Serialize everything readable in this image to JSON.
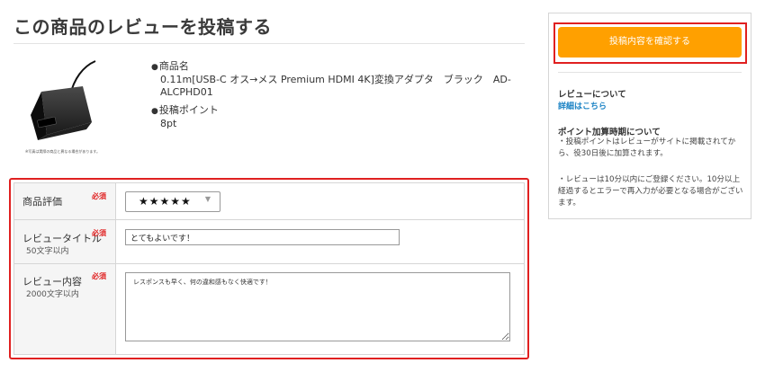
{
  "header": {
    "title": "この商品のレビューを投稿する"
  },
  "product": {
    "image_caption": "※写真は実際の商品と異なる場合があります。",
    "name_label": "商品名",
    "name": "0.11m[USB-C オス→メス Premium HDMI 4K]変換アダプタ　ブラック　AD-ALCPHD01",
    "points_label": "投稿ポイント",
    "points": "8pt"
  },
  "form": {
    "required_label": "必須",
    "rating": {
      "label": "商品評価",
      "value": "★★★★★"
    },
    "title": {
      "label": "レビュータイトル",
      "hint": "50文字以内",
      "value": "とてもよいです！"
    },
    "content": {
      "label": "レビュー内容",
      "hint": "2000文字以内",
      "value": "レスポンスも早く、何の違和感もなく快適です！"
    }
  },
  "sidebar": {
    "confirm_button": "投稿内容を確認する",
    "about_heading": "レビューについて",
    "details_link": "詳細はこちら",
    "points_heading": "ポイント加算時期について",
    "notes": [
      "・投稿ポイントはレビューがサイトに掲載されてから、役30日後に加算されます。",
      "・レビューは10分以内にご登録ください。10分以上経過するとエラーで再入力が必要となる場合がございます。"
    ]
  },
  "colors": {
    "accent": "#ffa000",
    "highlight": "#e02020",
    "link": "#1a82c4"
  }
}
